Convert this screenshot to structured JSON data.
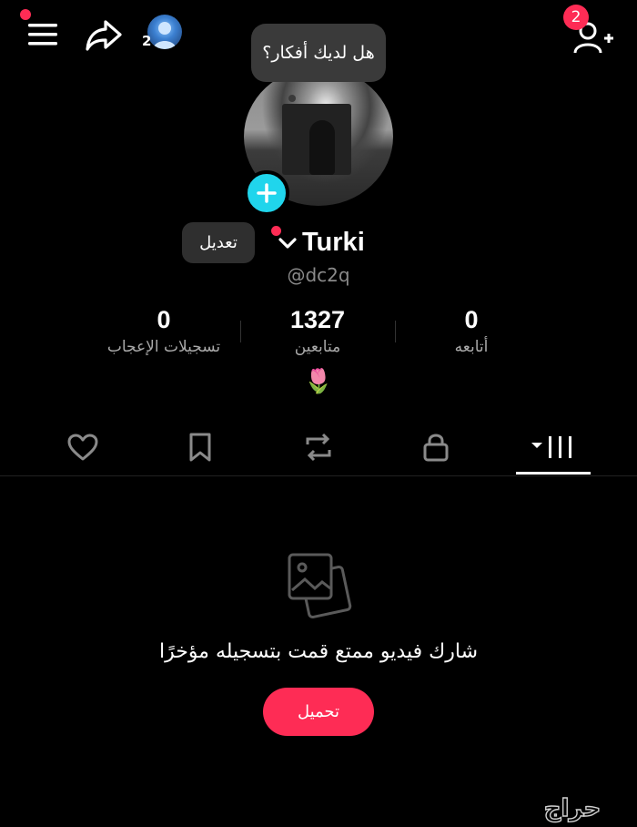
{
  "header": {
    "mini_avatar_count": "2",
    "follow_request_badge": "2"
  },
  "profile": {
    "thought_bubble": "هل لديك أفكار؟",
    "edit_label": "تعديل",
    "display_name": "Turki",
    "username": "@dc2q",
    "bio_emoji": "🌷"
  },
  "stats": [
    {
      "value": "0",
      "label": "تسجيلات الإعجاب"
    },
    {
      "value": "1327",
      "label": "متابعين"
    },
    {
      "value": "0",
      "label": "أتابعه"
    }
  ],
  "tabs": [
    {
      "icon": "heart-icon"
    },
    {
      "icon": "bookmark-icon"
    },
    {
      "icon": "repost-icon"
    },
    {
      "icon": "lock-icon"
    },
    {
      "icon": "videos-grid-icon",
      "active": true
    }
  ],
  "empty_state": {
    "message": "شارك فيديو ممتع قمت بتسجيله مؤخرًا",
    "upload_label": "تحميل"
  },
  "watermark": "حراج",
  "colors": {
    "background": "#000000",
    "accent_red": "#fe2c55",
    "accent_cyan": "#20d5ec",
    "muted_text": "#a9a9a9"
  }
}
